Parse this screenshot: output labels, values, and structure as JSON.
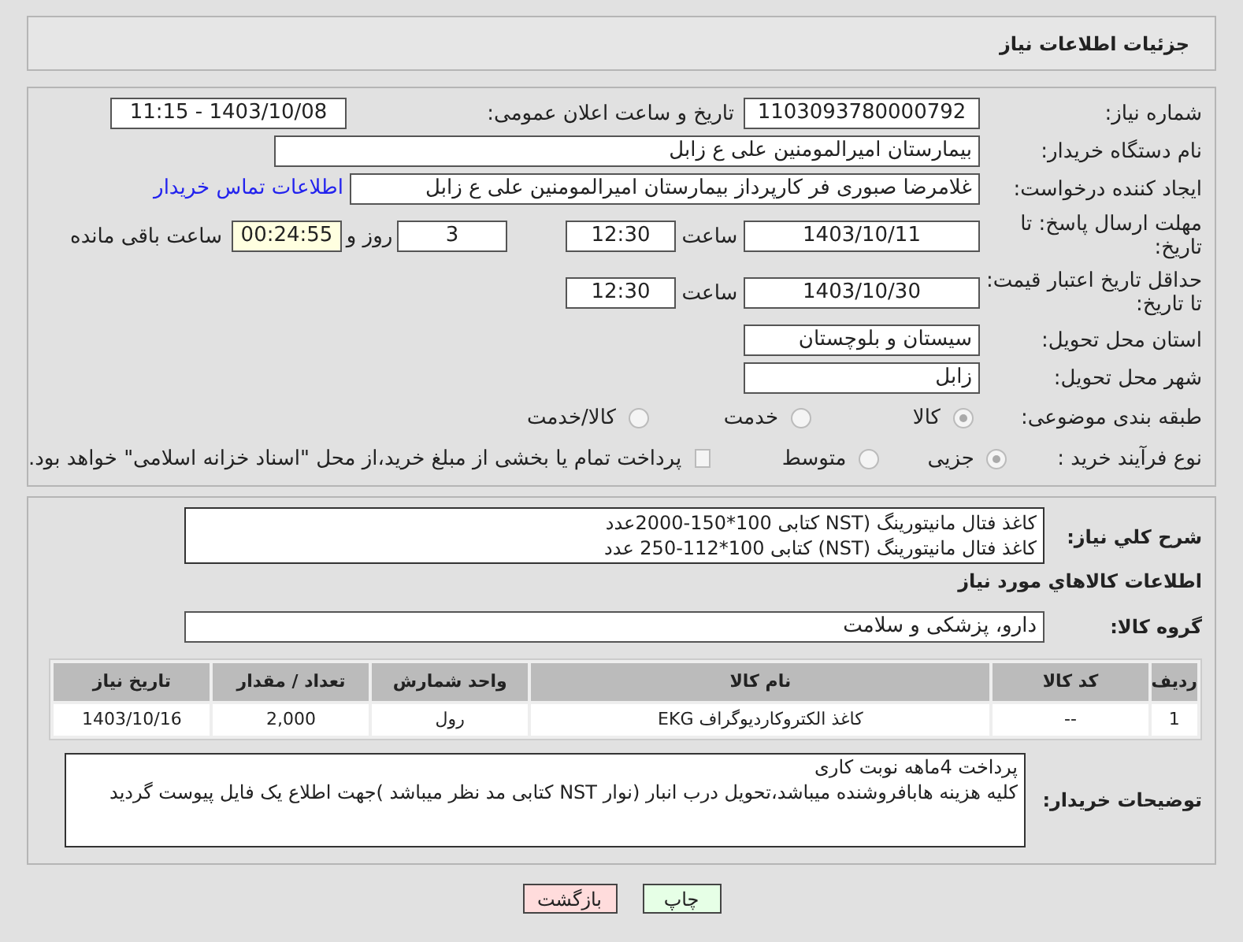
{
  "header": {
    "title": "جزئیات اطلاعات نیاز"
  },
  "need_number": {
    "label": "شماره نیاز:",
    "value": "1103093780000792"
  },
  "announce": {
    "label": "تاریخ و ساعت اعلان عمومی:",
    "value": "1403/10/08 - 11:15"
  },
  "buyer_org": {
    "label": "نام دستگاه خریدار:",
    "value": "بیمارستان امیرالمومنین علی  ع  زابل"
  },
  "requester": {
    "label": "ایجاد کننده درخواست:",
    "value": "غلامرضا صبوری فر کارپرداز بیمارستان امیرالمومنین علی  ع  زابل",
    "link": "اطلاعات تماس خریدار"
  },
  "reply_deadline": {
    "label": "مهلت ارسال پاسخ: تا تاریخ:",
    "date": "1403/10/11",
    "time_label": "ساعت",
    "time": "12:30",
    "days": "3",
    "days_label": "روز و",
    "remaining": "00:24:55",
    "remaining_label": "ساعت باقی مانده"
  },
  "price_validity": {
    "label": "حداقل تاریخ اعتبار قیمت: تا تاریخ:",
    "date": "1403/10/30",
    "time_label": "ساعت",
    "time": "12:30"
  },
  "province": {
    "label": "استان محل تحویل:",
    "value": "سیستان و بلوچستان"
  },
  "city": {
    "label": "شهر محل تحویل:",
    "value": "زابل"
  },
  "category": {
    "label": "طبقه بندی موضوعی:",
    "options": [
      {
        "label": "کالا",
        "selected": true
      },
      {
        "label": "خدمت",
        "selected": false
      },
      {
        "label": "کالا/خدمت",
        "selected": false
      }
    ]
  },
  "purchase_type": {
    "label": "نوع فرآیند خرید :",
    "options": [
      {
        "label": "جزیی",
        "selected": true
      },
      {
        "label": "متوسط",
        "selected": false
      }
    ],
    "treasury": {
      "label": "پرداخت تمام یا بخشی از مبلغ خرید،از محل \"اسناد خزانه اسلامی\" خواهد بود.",
      "checked": false
    }
  },
  "description": {
    "label": "شرح کلي نياز:",
    "lines": [
      "کاغذ فتال مانیتورینگ (NST  کتابی 100*150-2000عدد",
      "کاغذ فتال مانیتورینگ (NST) کتابی 100*112-250 عدد"
    ]
  },
  "goods_title": "اطلاعات کالاهاي مورد نياز",
  "goods_group": {
    "label": "گروه کالا:",
    "value": "دارو، پزشکی و سلامت"
  },
  "table": {
    "columns": [
      "ردیف",
      "کد کالا",
      "نام کالا",
      "واحد شمارش",
      "تعداد / مقدار",
      "تاریخ نیاز"
    ],
    "rows": [
      [
        "1",
        "--",
        "کاغذ الکتروکاردیوگراف EKG",
        "رول",
        "2,000",
        "1403/10/16"
      ]
    ]
  },
  "buyer_notes": {
    "label": "توضیحات خریدار:",
    "lines": [
      "پرداخت 4ماهه نوبت کاری",
      "کلیه هزینه هابافروشنده میباشد،تحویل درب انبار (نوار NST کتابی مد نظر میباشد )جهت اطلاع یک فایل پیوست گردید"
    ]
  },
  "buttons": [
    {
      "label": "چاپ",
      "kind": "print"
    },
    {
      "label": "بازگشت",
      "kind": "back"
    }
  ]
}
